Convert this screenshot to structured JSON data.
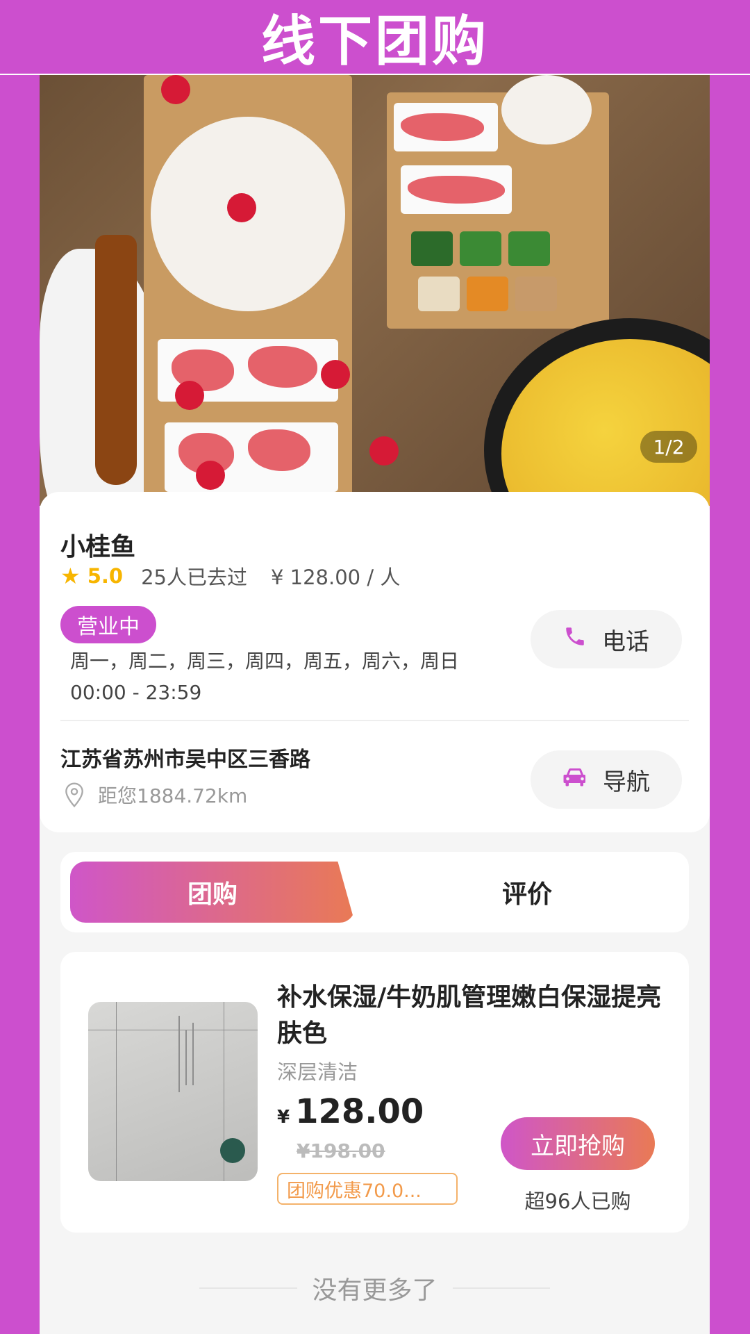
{
  "header": {
    "title": "线下团购"
  },
  "hero": {
    "image_counter": "1/2"
  },
  "store": {
    "name": "小桂鱼",
    "rating": "5.0",
    "visits": "25人已去过",
    "price_per_person": "¥ 128.00 / 人",
    "status_badge": "营业中",
    "open_days": "周一，周二，周三，周四，周五，周六，周日",
    "open_hours": "00:00 - 23:59",
    "call_label": "电话",
    "address": "江苏省苏州市吴中区三香路",
    "distance": "距您1884.72km",
    "nav_label": "导航"
  },
  "tabs": [
    {
      "label": "团购",
      "active": true
    },
    {
      "label": "评价",
      "active": false
    }
  ],
  "deal": {
    "title": "补水保湿/牛奶肌管理嫩白保湿提亮肤色",
    "subtitle": "深层清洁",
    "currency": "¥",
    "price": "128.00",
    "original_price": "¥198.00",
    "discount_tag": "团购优惠70.0...",
    "buy_label": "立即抢购",
    "sold": "超96人已购"
  },
  "footer": {
    "end_text": "没有更多了"
  },
  "colors": {
    "brand": "#cc4fce",
    "gradient_end": "#e97a55",
    "rating": "#f7b500",
    "discount": "#f29a4a"
  },
  "icons": [
    "star-icon",
    "phone-icon",
    "location-pin-icon",
    "car-icon"
  ]
}
